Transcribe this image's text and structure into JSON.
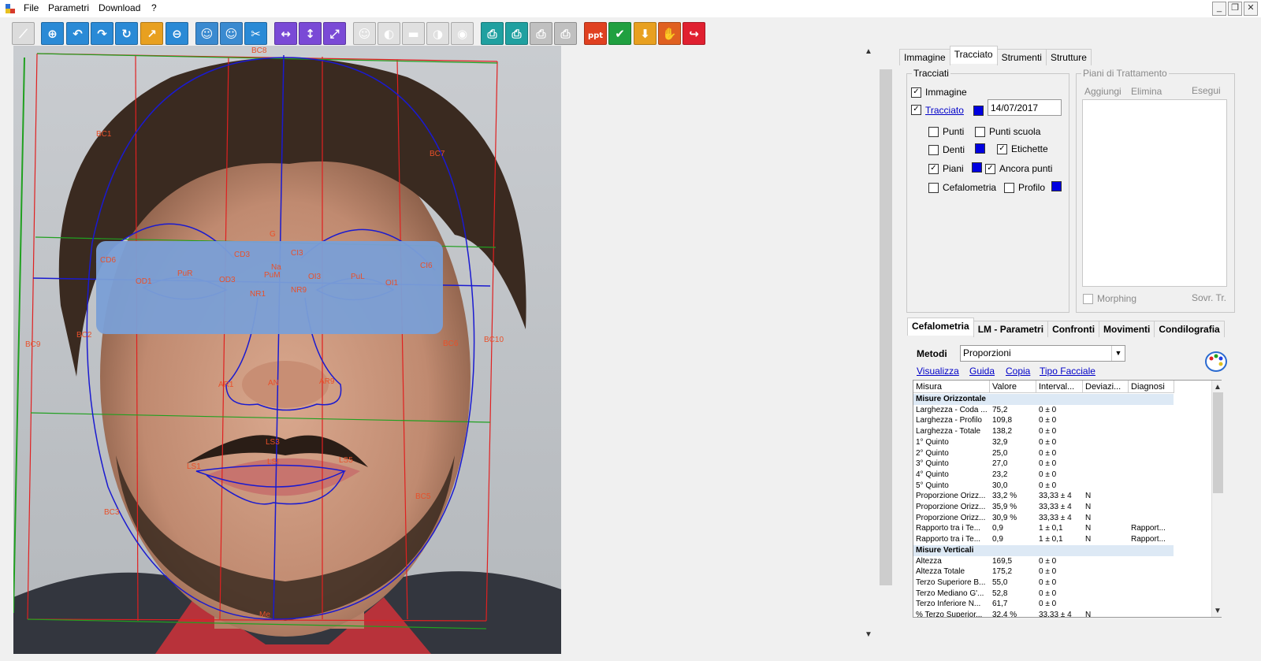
{
  "menu": [
    "File",
    "Parametri",
    "Download",
    "?"
  ],
  "window_buttons": [
    "_",
    "❐",
    "✕"
  ],
  "toolbar_icons": [
    "ruler-icon",
    "zoom-in-icon",
    "undo-icon",
    "redo-icon",
    "rotate-icon",
    "move-point-icon",
    "zoom-out-icon",
    "patient-icon",
    "patient-search-icon",
    "crop-icon",
    "flip-horizontal-icon",
    "flip-vertical-icon",
    "resize-icon",
    "portrait-icon",
    "profile-icon",
    "lips-icon",
    "face-half-icon",
    "eye-icon",
    "print-icon",
    "print-color-icon",
    "print-gray-icon",
    "print-multi-icon",
    "powerpoint-icon",
    "confirm-icon",
    "download-icon",
    "hand-icon",
    "exit-icon"
  ],
  "landmarks": {
    "BC8": "BC8",
    "BC1": "BC1",
    "BC7": "BC7",
    "G": "G",
    "CD6": "CD6",
    "CD3": "CD3",
    "CI3": "CI3",
    "CI6": "CI6",
    "Na": "Na",
    "PuR": "PuR",
    "PuM": "PuM",
    "PuL": "PuL",
    "OD1": "OD1",
    "OD3": "OD3",
    "OI3": "OI3",
    "OI1": "OI1",
    "NR1": "NR1",
    "NR9": "NR9",
    "BC9": "BC9",
    "BC2": "BC2",
    "BC6": "BC6",
    "BC10": "BC10",
    "AR1": "AR1",
    "AN": "AN",
    "AR9": "AR9",
    "LS3": "LS3",
    "LSI": "LSI",
    "LS1": "LS1",
    "LS5": "LS5",
    "BC5": "BC5",
    "BC3": "BC3",
    "Me": "Me"
  },
  "top_tabs": [
    "Immagine",
    "Tracciato",
    "Strumenti",
    "Strutture"
  ],
  "tracciati": {
    "title": "Tracciati",
    "immagine": "Immagine",
    "tracciato": "Tracciato",
    "date": "14/07/2017",
    "punti": "Punti",
    "punti_scuola": "Punti scuola",
    "denti": "Denti",
    "etichette": "Etichette",
    "piani": "Piani",
    "ancora_punti": "Ancora punti",
    "cefalometria": "Cefalometria",
    "profilo": "Profilo"
  },
  "piani_trattamento": {
    "title": "Piani di Trattamento",
    "aggiungi": "Aggiungi",
    "elimina": "Elimina",
    "esegui": "Esegui",
    "morphing": "Morphing",
    "sovr": "Sovr. Tr."
  },
  "bottom_tabs": [
    "Cefalometria",
    "LM - Parametri",
    "Confronti",
    "Movimenti",
    "Condilografia"
  ],
  "metodi": {
    "label": "Metodi",
    "value": "Proporzioni"
  },
  "links": [
    "Visualizza",
    "Guida",
    "Copia",
    "Tipo Facciale"
  ],
  "grid_headers": [
    "Misura",
    "Valore",
    "Interval...",
    "Deviazi...",
    "Diagnosi"
  ],
  "grid_rows": [
    {
      "section": "Misure Orizzontale"
    },
    {
      "c": [
        "Larghezza - Coda ...",
        "75,2",
        "0 ± 0",
        "",
        ""
      ]
    },
    {
      "c": [
        "Larghezza - Profilo",
        "109,8",
        "0 ± 0",
        "",
        ""
      ]
    },
    {
      "c": [
        "Larghezza - Totale",
        "138,2",
        "0 ± 0",
        "",
        ""
      ]
    },
    {
      "c": [
        "1° Quinto",
        "32,9",
        "0 ± 0",
        "",
        ""
      ]
    },
    {
      "c": [
        "2° Quinto",
        "25,0",
        "0 ± 0",
        "",
        ""
      ]
    },
    {
      "c": [
        "3° Quinto",
        "27,0",
        "0 ± 0",
        "",
        ""
      ]
    },
    {
      "c": [
        "4° Quinto",
        "23,2",
        "0 ± 0",
        "",
        ""
      ]
    },
    {
      "c": [
        "5° Quinto",
        "30,0",
        "0 ± 0",
        "",
        ""
      ]
    },
    {
      "c": [
        "Proporzione Orizz...",
        "33,2 %",
        "33,33 ± 4",
        "N",
        ""
      ]
    },
    {
      "c": [
        "Proporzione Orizz...",
        "35,9 %",
        "33,33 ± 4",
        "N",
        ""
      ]
    },
    {
      "c": [
        "Proporzione Orizz...",
        "30,9 %",
        "33,33 ± 4",
        "N",
        ""
      ]
    },
    {
      "c": [
        "Rapporto tra i Te...",
        "0,9",
        "1 ± 0,1",
        "N",
        "Rapport..."
      ]
    },
    {
      "c": [
        "Rapporto tra i Te...",
        "0,9",
        "1 ± 0,1",
        "N",
        "Rapport..."
      ]
    },
    {
      "section": "Misure Verticali"
    },
    {
      "c": [
        "Altezza",
        "169,5",
        "0 ± 0",
        "",
        ""
      ]
    },
    {
      "c": [
        "Altezza Totale",
        "175,2",
        "0 ± 0",
        "",
        ""
      ]
    },
    {
      "c": [
        "Terzo Superiore B...",
        "55,0",
        "0 ± 0",
        "",
        ""
      ]
    },
    {
      "c": [
        "Terzo Mediano G'...",
        "52,8",
        "0 ± 0",
        "",
        ""
      ]
    },
    {
      "c": [
        "Terzo Inferiore N...",
        "61,7",
        "0 ± 0",
        "",
        ""
      ]
    },
    {
      "c": [
        "% Terzo Superior...",
        "32,4 %",
        "33,33 ± 4",
        "N",
        ""
      ]
    }
  ],
  "colors": {
    "accent": "#0000e0",
    "trace": "#1a1ad0",
    "grid_red": "#e02020",
    "grid_green": "#20a020",
    "mask": "#7a9fd6"
  }
}
